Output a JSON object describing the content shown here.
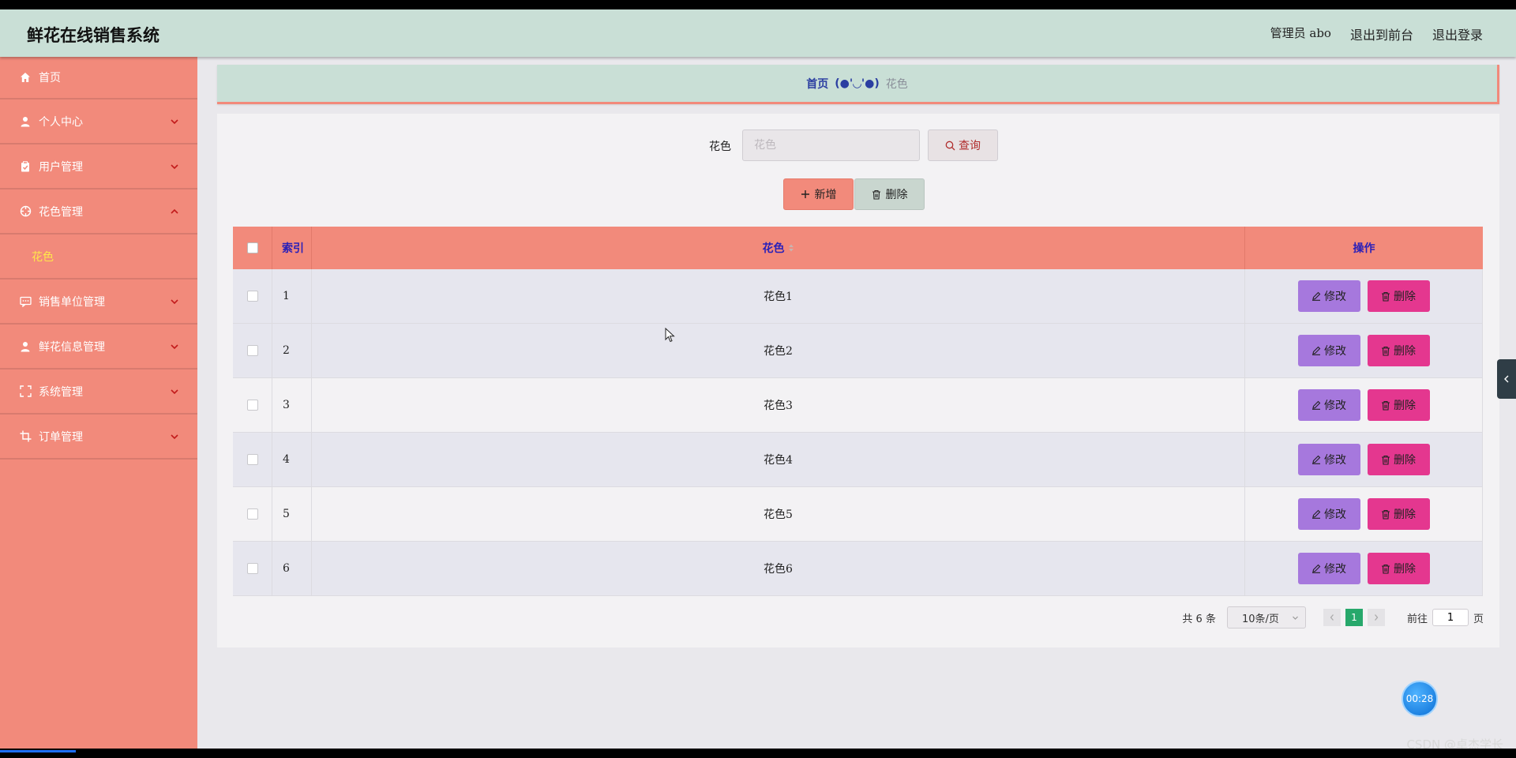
{
  "header": {
    "title": "鲜花在线销售系统",
    "admin": "管理员 abo",
    "to_front": "退出到前台",
    "logout": "退出登录"
  },
  "sidebar": {
    "items": [
      {
        "label": "首页",
        "icon": "home-icon"
      },
      {
        "label": "个人中心",
        "icon": "user-icon"
      },
      {
        "label": "用户管理",
        "icon": "clipboard-icon"
      },
      {
        "label": "花色管理",
        "icon": "crosshair-icon",
        "expanded": true,
        "children": [
          "花色"
        ]
      },
      {
        "label": "销售单位管理",
        "icon": "chat-icon"
      },
      {
        "label": "鲜花信息管理",
        "icon": "person-icon"
      },
      {
        "label": "系统管理",
        "icon": "frame-icon"
      },
      {
        "label": "订单管理",
        "icon": "crop-icon"
      }
    ],
    "active_sub": "花色"
  },
  "breadcrumb": {
    "home": "首页",
    "face": "(●'◡'●)",
    "current": "花色"
  },
  "search": {
    "label": "花色",
    "placeholder": "花色",
    "button": "查询"
  },
  "actions": {
    "add": "新增",
    "delete": "删除"
  },
  "table": {
    "columns": [
      "索引",
      "花色",
      "操作"
    ],
    "rows": [
      {
        "index": "1",
        "name": "花色1"
      },
      {
        "index": "2",
        "name": "花色2"
      },
      {
        "index": "3",
        "name": "花色3"
      },
      {
        "index": "4",
        "name": "花色4"
      },
      {
        "index": "5",
        "name": "花色5"
      },
      {
        "index": "6",
        "name": "花色6"
      }
    ],
    "edit_label": "修改",
    "delete_label": "删除"
  },
  "pagination": {
    "total": "共 6 条",
    "page_size": "10条/页",
    "current_page": "1",
    "goto_label": "前往",
    "goto_value": "1",
    "page_suffix": "页"
  },
  "overlay": {
    "timer": "00:28",
    "watermark": "CSDN @卓杰学长"
  },
  "colors": {
    "header_bg": "#c9dfd6",
    "sidebar_bg": "#f28a7b",
    "edit_button": "#a678dd",
    "delete_button": "#e4378f",
    "active_page": "#27a86b"
  }
}
